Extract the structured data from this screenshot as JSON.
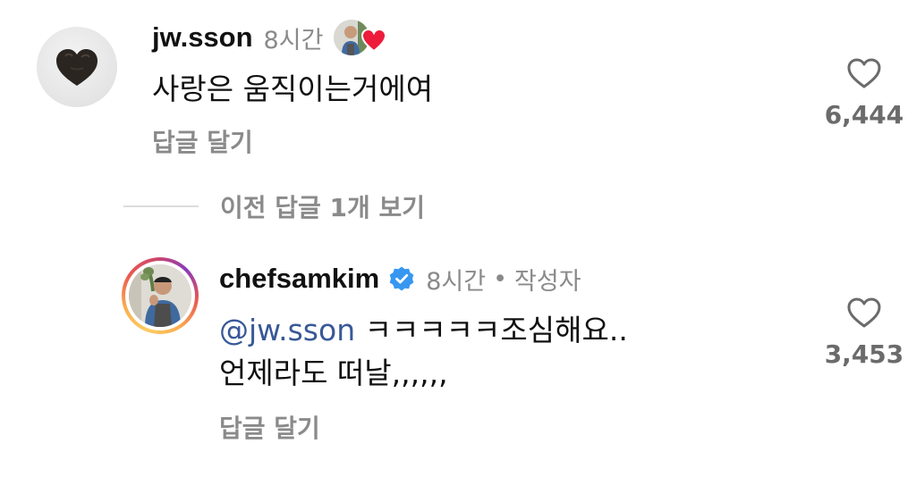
{
  "comments": [
    {
      "username": "jw.sson",
      "time": "8시간",
      "text": "사랑은 움직이는거에여",
      "reply_label": "답글 달기",
      "like_count": "6,444",
      "liked_by_author": true,
      "avatar_icon": "heart-shaped-truffle",
      "colors": {
        "liked_heart": "#ed1c3b"
      }
    },
    {
      "username": "chefsamkim",
      "verified": true,
      "time": "8시간",
      "separator": "•",
      "author_badge": "작성자",
      "mention_icon": "@",
      "mention": "jw.sson",
      "text_line1_rest": " ㅋㅋㅋㅋㅋ조심해요..",
      "text_line2": "언제라도 떠날,,,,,,",
      "reply_label": "답글 달기",
      "like_count": "3,453",
      "colors": {
        "verified": "#3797f0",
        "mention": "#385898"
      }
    }
  ],
  "view_previous_replies": "이전 답글 1개 보기"
}
